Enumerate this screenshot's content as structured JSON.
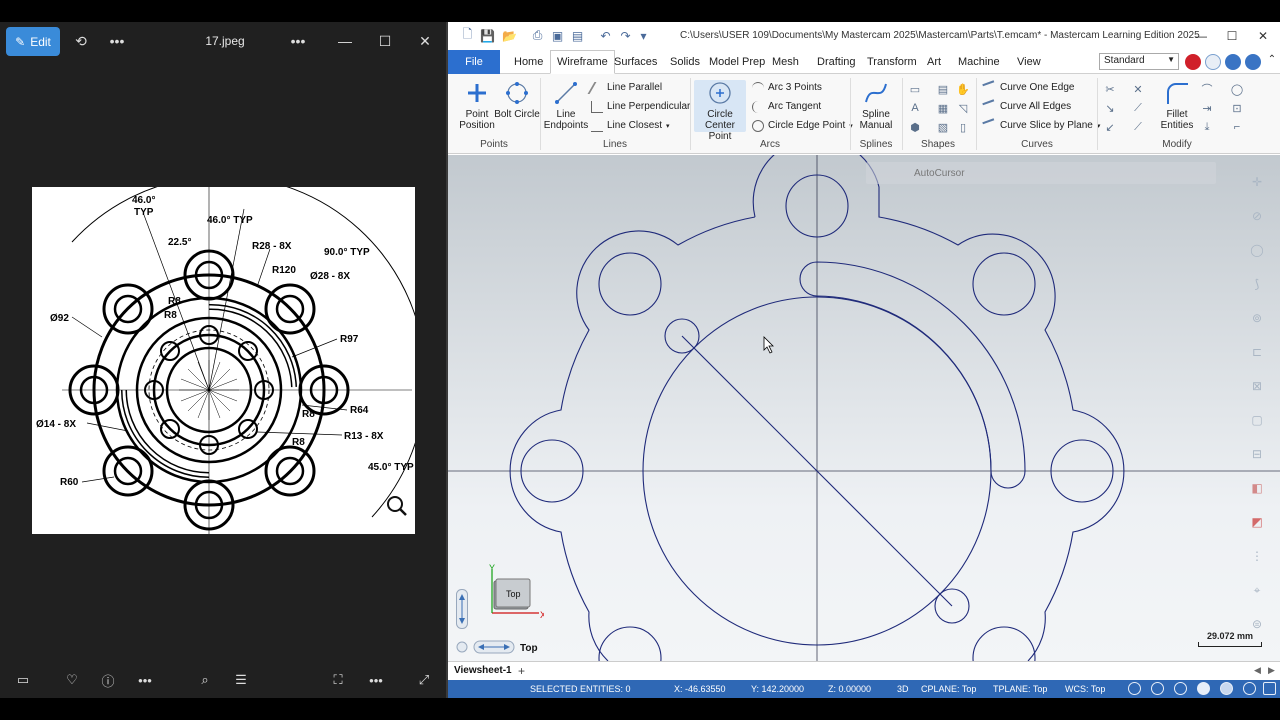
{
  "photos": {
    "edit_label": "Edit",
    "filename": "17.jpeg",
    "icons": [
      "rotate-icon",
      "more-icon",
      "more-icon",
      "minimize-icon",
      "maximize-icon",
      "close-icon"
    ],
    "bottom_icons": [
      "filmstrip-icon",
      "heart-icon",
      "info-icon",
      "more-icon",
      "visual-search-icon",
      "text-select-icon",
      "fit-icon",
      "more-icon",
      "fullscreen-icon"
    ],
    "drawing": {
      "dim_46_typ_a": "46.0°",
      "dim_typ_a": "TYP",
      "dim_46_typ_b": "46.0° TYP",
      "dim_22_5": "22.5°",
      "dim_r28": "R28 - 8X",
      "dim_r120": "R120",
      "dim_d28": "Ø28 - 8X",
      "dim_90_typ": "90.0° TYP",
      "dim_r8_a": "R8",
      "dim_r8_b": "R8",
      "dim_d92": "Ø92",
      "dim_r97": "R97",
      "dim_r8_c": "R8",
      "dim_r64": "R64",
      "dim_d14": "Ø14 - 8X",
      "dim_r13": "R13 - 8X",
      "dim_r8_d": "R8",
      "dim_45_typ": "45.0° TYP",
      "dim_r60": "R60"
    }
  },
  "mastercam": {
    "title": "C:\\Users\\USER 109\\Documents\\My Mastercam 2025\\Mastercam\\Parts\\T.emcam* - Mastercam Learning Edition 2025",
    "tabs": [
      "File",
      "Home",
      "Wireframe",
      "Surfaces",
      "Solids",
      "Model Prep",
      "Mesh",
      "Drafting",
      "Transform",
      "Art",
      "Machine",
      "View"
    ],
    "active_tab": "Wireframe",
    "standard": "Standard",
    "ribbon": {
      "point_position": "Point Position",
      "bolt_circle": "Bolt Circle",
      "line_endpoints": "Line Endpoints",
      "line_parallel": "Line Parallel",
      "line_perpendicular": "Line Perpendicular",
      "line_closest": "Line Closest",
      "circle_center_point": "Circle Center Point",
      "arc_3_points": "Arc 3 Points",
      "arc_tangent": "Arc Tangent",
      "circle_edge_point": "Circle Edge Point",
      "spline_manual": "Spline Manual",
      "curve_one_edge": "Curve One Edge",
      "curve_all_edges": "Curve All Edges",
      "curve_slice_by_plane": "Curve Slice by Plane",
      "fillet_entities": "Fillet Entities",
      "groups": {
        "points": "Points",
        "lines": "Lines",
        "arcs": "Arcs",
        "splines": "Splines",
        "shapes": "Shapes",
        "curves": "Curves",
        "modify": "Modify"
      }
    },
    "autocursor": "AutoCursor",
    "scale": "29.072 mm",
    "gnomon_label": "Top",
    "gnomon_x": "X",
    "gnomon_y": "Y",
    "view_name": "Top",
    "sheet_tab": "Viewsheet-1",
    "sheet_add": "+",
    "status": {
      "selected": "SELECTED ENTITIES: 0",
      "x": "X:   -46.63550",
      "y": "Y:   142.20000",
      "z": "Z:   0.00000",
      "mode": "3D",
      "cplane": "CPLANE: Top",
      "tplane": "TPLANE: Top",
      "wcs": "WCS: Top"
    },
    "colors": {
      "geometry": "#1f2a7a",
      "file_tab": "#2c6fcf",
      "status_bar": "#2f68b5"
    }
  }
}
